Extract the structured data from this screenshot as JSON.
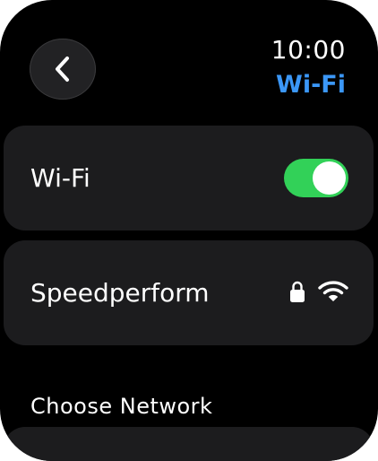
{
  "status": {
    "time": "10:00"
  },
  "header": {
    "title": "Wi-Fi",
    "back_icon": "chevron-left-icon"
  },
  "wifi_toggle": {
    "label": "Wi-Fi",
    "on": true,
    "on_color": "#32d158"
  },
  "network": {
    "name": "Speedperform",
    "secured": true,
    "lock_icon": "lock-icon",
    "signal_icon": "wifi-icon"
  },
  "section": {
    "label": "Choose Network"
  },
  "colors": {
    "accent": "#3b97f7",
    "background": "#000000",
    "card": "#1c1c1e"
  }
}
